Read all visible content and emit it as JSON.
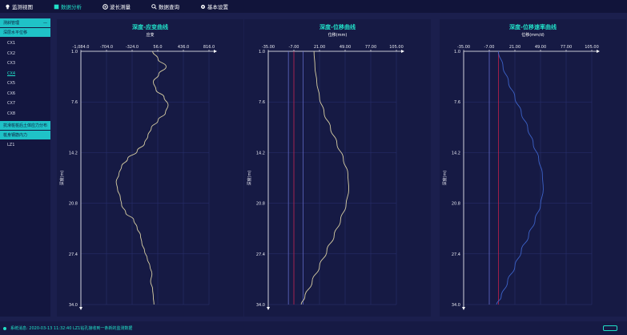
{
  "menu": [
    {
      "label": "监测视图",
      "icon": "bulb-icon",
      "active": false
    },
    {
      "label": "数据分析",
      "icon": "chart-icon",
      "active": true
    },
    {
      "label": "波长测量",
      "icon": "target-icon",
      "active": false
    },
    {
      "label": "数据查询",
      "icon": "search-icon",
      "active": false
    },
    {
      "label": "基本设置",
      "icon": "gear-icon",
      "active": false
    }
  ],
  "sidebar": {
    "section1": "测斜管理",
    "section2": "深层水平位移",
    "items1": [
      "CX1",
      "CX2",
      "CX3",
      "CX4",
      "CX5",
      "CX6",
      "CX7",
      "CX8"
    ],
    "active_item": "CX4",
    "section3": "抗滑桩桩后土体应力分布",
    "section4": "桩身钢筋内力",
    "items2": [
      "LZ1"
    ]
  },
  "status": {
    "text": "系统消息: 2020-03-13 11:32:40 LZ1钻孔接收到一条新的监测数据"
  },
  "chart_data": [
    {
      "type": "line",
      "title": "深度-应变曲线",
      "xlabel": "应变",
      "ylabel": "深度(m)",
      "xticks": [
        "-1,084.0",
        "-704.0",
        "-324.0",
        "56.0",
        "436.0",
        "816.0"
      ],
      "yticks": [
        "1.0",
        "7.6",
        "14.2",
        "20.8",
        "27.4",
        "34.0"
      ],
      "xlim": [
        -1084,
        816
      ],
      "ylim": [
        1,
        34
      ],
      "series": [
        {
          "color": "#d8cfa4",
          "points": [
            [
              -20,
              1
            ],
            [
              60,
              2
            ],
            [
              180,
              3
            ],
            [
              70,
              4
            ],
            [
              -10,
              5
            ],
            [
              30,
              6
            ],
            [
              150,
              7
            ],
            [
              210,
              8
            ],
            [
              170,
              9
            ],
            [
              60,
              10
            ],
            [
              -40,
              11
            ],
            [
              -90,
              12
            ],
            [
              -140,
              13
            ],
            [
              -250,
              14
            ],
            [
              -390,
              15
            ],
            [
              -480,
              16
            ],
            [
              -520,
              17
            ],
            [
              -560,
              18
            ],
            [
              -540,
              19
            ],
            [
              -500,
              20
            ],
            [
              -480,
              21
            ],
            [
              -420,
              22
            ],
            [
              -300,
              23
            ],
            [
              -250,
              24
            ],
            [
              -200,
              25
            ],
            [
              -180,
              26
            ],
            [
              -140,
              27
            ],
            [
              -100,
              28
            ],
            [
              -60,
              29
            ],
            [
              -30,
              30
            ],
            [
              -50,
              31
            ],
            [
              -20,
              32
            ],
            [
              -10,
              33
            ],
            [
              0,
              34
            ]
          ]
        }
      ],
      "vlines": []
    },
    {
      "type": "line",
      "title": "深度-位移曲线",
      "xlabel": "位移(mm)",
      "ylabel": "深度(m)",
      "xticks": [
        "-35.00",
        "-7.00",
        "21.00",
        "49.00",
        "77.00",
        "105.00"
      ],
      "yticks": [
        "1.0",
        "7.6",
        "14.2",
        "20.8",
        "27.4",
        "34.0"
      ],
      "xlim": [
        -35,
        105
      ],
      "ylim": [
        1,
        34
      ],
      "series": [
        {
          "color": "#d8cfa4",
          "points": [
            [
              15,
              1
            ],
            [
              16,
              3
            ],
            [
              18,
              5
            ],
            [
              21,
              7
            ],
            [
              26,
              9
            ],
            [
              33,
              11
            ],
            [
              40,
              13
            ],
            [
              47,
              15
            ],
            [
              52,
              17
            ],
            [
              53,
              19
            ],
            [
              50,
              21
            ],
            [
              44,
              23
            ],
            [
              37,
              25
            ],
            [
              29,
              27
            ],
            [
              21,
              29
            ],
            [
              13,
              31
            ],
            [
              5,
              33
            ],
            [
              1,
              34
            ]
          ]
        }
      ],
      "vlines": [
        {
          "x": -7,
          "color": "#d9204a"
        },
        {
          "x": -13,
          "color": "#6a73d6"
        },
        {
          "x": 3,
          "color": "#6a73d6"
        }
      ]
    },
    {
      "type": "line",
      "title": "深度-位移速率曲线",
      "xlabel": "位移(mm/d)",
      "ylabel": "深度(m)",
      "xticks": [
        "-35.00",
        "-7.00",
        "21.00",
        "49.00",
        "77.00",
        "105.00"
      ],
      "yticks": [
        "1.0",
        "7.6",
        "14.2",
        "20.8",
        "27.4",
        "34.0"
      ],
      "xlim": [
        -35,
        105
      ],
      "ylim": [
        1,
        34
      ],
      "series": [
        {
          "color": "#3d63c9",
          "points": [
            [
              3,
              1
            ],
            [
              8,
              3
            ],
            [
              14,
              5
            ],
            [
              21,
              7
            ],
            [
              28,
              9
            ],
            [
              35,
              11
            ],
            [
              41,
              13
            ],
            [
              47,
              15
            ],
            [
              51,
              17
            ],
            [
              52,
              19
            ],
            [
              49,
              21
            ],
            [
              43,
              23
            ],
            [
              36,
              25
            ],
            [
              28,
              27
            ],
            [
              21,
              29
            ],
            [
              13,
              31
            ],
            [
              6,
              33
            ],
            [
              1,
              34
            ]
          ]
        }
      ],
      "vlines": [
        {
          "x": -7,
          "color": "#6a73d6"
        },
        {
          "x": 3,
          "color": "#d9204a"
        }
      ]
    }
  ]
}
